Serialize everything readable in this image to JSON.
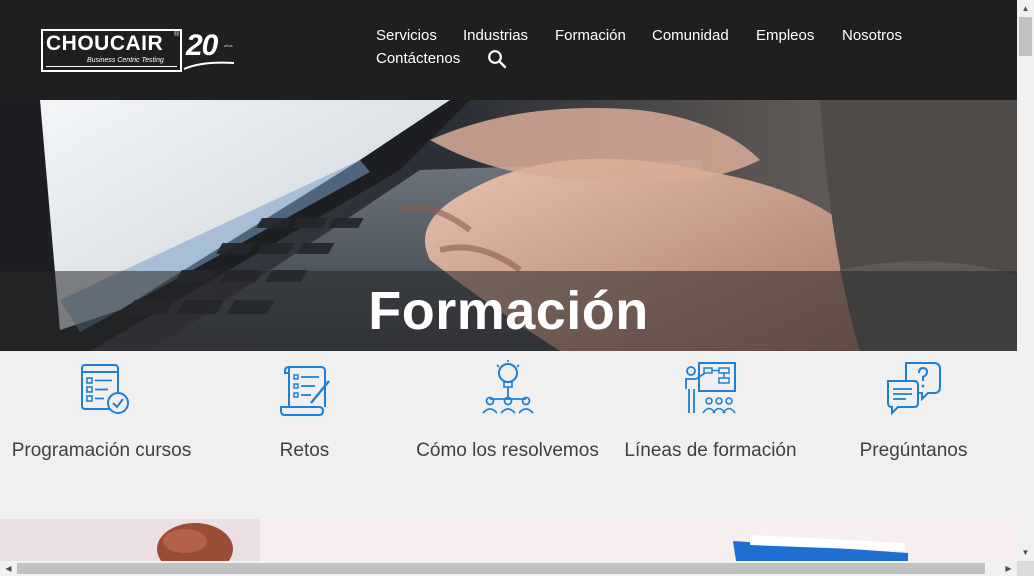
{
  "header": {
    "logo": {
      "brand": "CHOUCAIR",
      "tagline": "Business Centric Testing",
      "anniversary": "20",
      "anniversary_sub": "años"
    },
    "nav": [
      {
        "label": "Servicios"
      },
      {
        "label": "Industrias"
      },
      {
        "label": "Formación"
      },
      {
        "label": "Comunidad"
      },
      {
        "label": "Empleos"
      },
      {
        "label": "Nosotros"
      },
      {
        "label": "Contáctenos"
      }
    ],
    "search_icon": "search-icon"
  },
  "hero": {
    "title": "Formación"
  },
  "menu": [
    {
      "label": "Programación cursos",
      "icon": "course-checklist-icon"
    },
    {
      "label": "Retos",
      "icon": "challenge-scroll-icon"
    },
    {
      "label": "Cómo los resolvemos",
      "icon": "idea-network-icon"
    },
    {
      "label": "Líneas de formación",
      "icon": "training-board-icon"
    },
    {
      "label": "Pregúntanos",
      "icon": "question-chat-icon"
    }
  ],
  "colors": {
    "header_bg": "#1f1f1f",
    "accent_blue": "#1e7fd6",
    "strip_bg": "#f0f0f0",
    "label_text": "#404040"
  }
}
